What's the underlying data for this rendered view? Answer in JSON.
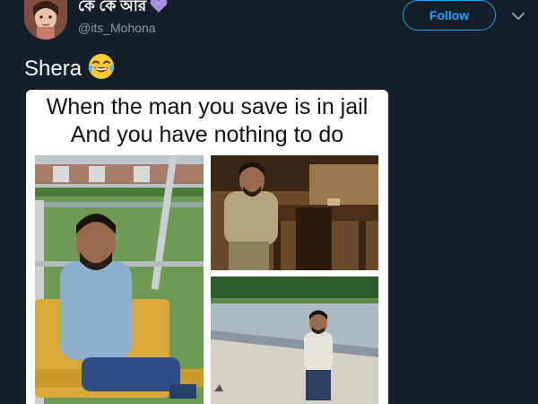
{
  "user": {
    "display_name": "কে কে আর",
    "handle": "@its_Mohona"
  },
  "actions": {
    "follow_label": "Follow"
  },
  "tweet": {
    "text": "Shera",
    "emoji": "face-with-tears-of-joy"
  },
  "meme": {
    "caption_line1": "When the man you save is in jail",
    "caption_line2": "And you have nothing to do"
  },
  "colors": {
    "background": "#15202b",
    "accent": "#1da1f2",
    "secondary_text": "#8899a6",
    "heart": "#a98ee0"
  }
}
